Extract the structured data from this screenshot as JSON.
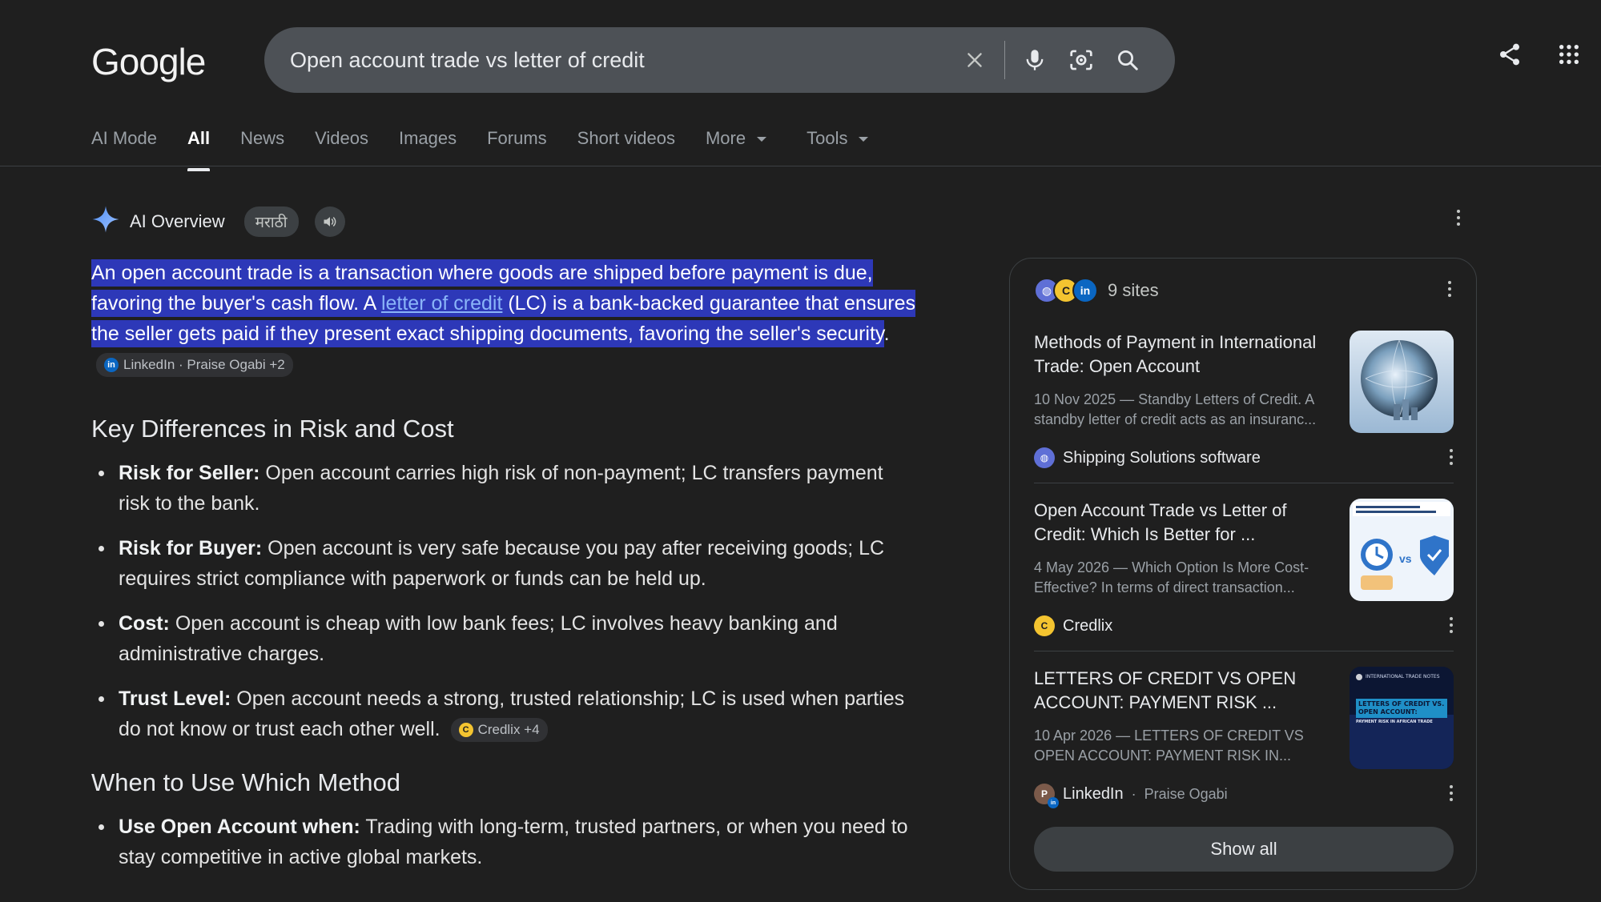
{
  "header": {
    "logo": "Google",
    "search_query": "Open account trade vs letter of credit"
  },
  "tabs": [
    {
      "label": "AI Mode"
    },
    {
      "label": "All"
    },
    {
      "label": "News"
    },
    {
      "label": "Videos"
    },
    {
      "label": "Images"
    },
    {
      "label": "Forums"
    },
    {
      "label": "Short videos"
    },
    {
      "label": "More"
    },
    {
      "label": "Tools"
    }
  ],
  "ai_overview": {
    "title": "AI Overview",
    "language_pill": "मराठी",
    "lead": {
      "part1": "An open account trade is a transaction where goods are shipped before payment is due, favoring the buyer's cash flow. A ",
      "link": "letter of credit",
      "part2": " (LC) is a bank-backed guarantee that ensures the seller gets paid if they present exact shipping documents, favoring the seller's security",
      "end": ".",
      "chip": "LinkedIn · Praise Ogabi +2"
    },
    "section1": {
      "heading": "Key Differences in Risk and Cost",
      "items": [
        {
          "label": "Risk for Seller:",
          "text": " Open account carries high risk of non-payment; LC transfers payment risk to the bank."
        },
        {
          "label": "Risk for Buyer:",
          "text": " Open account is very safe because you pay after receiving goods; LC requires strict compliance with paperwork or funds can be held up."
        },
        {
          "label": "Cost:",
          "text": " Open account is cheap with low bank fees; LC involves heavy banking and administrative charges."
        },
        {
          "label": "Trust Level:",
          "text": " Open account needs a strong, trusted relationship; LC is used when parties do not know or trust each other well.",
          "chip": "Credlix +4"
        }
      ]
    },
    "section2": {
      "heading": "When to Use Which Method",
      "items": [
        {
          "label": "Use Open Account when:",
          "text": " Trading with long-term, trusted partners, or when you need to stay competitive in active global markets."
        }
      ]
    }
  },
  "sources": {
    "count_label": "9 sites",
    "cards": [
      {
        "title": "Methods of Payment in International Trade: Open Account",
        "snippet": "10 Nov 2025 — Standby Letters of Credit. A standby letter of credit acts as an insuranc...",
        "source": "Shipping Solutions software",
        "author": ""
      },
      {
        "title": "Open Account Trade vs Letter of Credit: Which Is Better for ...",
        "snippet": "4 May 2026 — Which Option Is More Cost-Effective? In terms of direct transaction...",
        "source": "Credlix",
        "author": ""
      },
      {
        "title": "LETTERS OF CREDIT VS OPEN ACCOUNT: PAYMENT RISK ...",
        "snippet": "10 Apr 2026 — LETTERS OF CREDIT VS OPEN ACCOUNT: PAYMENT RISK IN...",
        "source": "LinkedIn",
        "author": "Praise Ogabi"
      }
    ],
    "thumb3": {
      "line1": "INTERNATIONAL TRADE NOTES",
      "line2": "LETTERS OF CREDIT VS.",
      "line3": "OPEN ACCOUNT:",
      "line4": "PAYMENT RISK IN AFRICAN TRADE"
    },
    "show_all": "Show all"
  },
  "colors": {
    "background": "#1f1f1f",
    "search_bg": "#4d5156",
    "highlight": "#2d38b8",
    "link": "#8ab4f8"
  }
}
